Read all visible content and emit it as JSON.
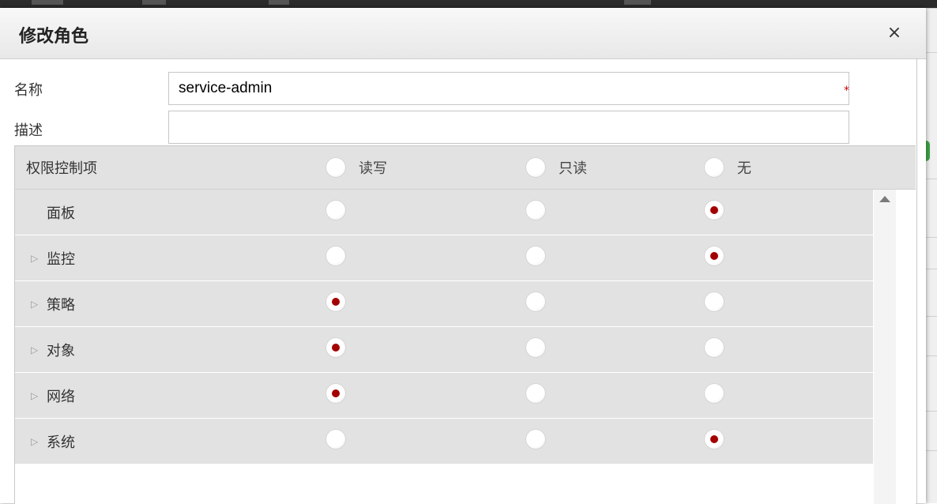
{
  "dialog": {
    "title": "修改角色",
    "close_label": "×"
  },
  "form": {
    "name_label": "名称",
    "name_value": "service-admin",
    "required_mark": "*",
    "desc_label": "描述",
    "desc_value": ""
  },
  "permissions": {
    "header_label": "权限控制项",
    "options": [
      "读写",
      "只读",
      "无"
    ],
    "rows": [
      {
        "label": "面板",
        "expandable": false,
        "selected": "无"
      },
      {
        "label": "监控",
        "expandable": true,
        "selected": "无"
      },
      {
        "label": "策略",
        "expandable": true,
        "selected": "读写"
      },
      {
        "label": "对象",
        "expandable": true,
        "selected": "读写"
      },
      {
        "label": "网络",
        "expandable": true,
        "selected": "读写"
      },
      {
        "label": "系统",
        "expandable": true,
        "selected": "无"
      }
    ]
  },
  "icons": {
    "expand": "triangle-right-icon",
    "scroll_up": "triangle-up-icon",
    "close": "close-icon"
  },
  "colors": {
    "radio_checked": "#a30000",
    "required_mark": "#cc0000",
    "row_background": "#e2e2e2"
  }
}
